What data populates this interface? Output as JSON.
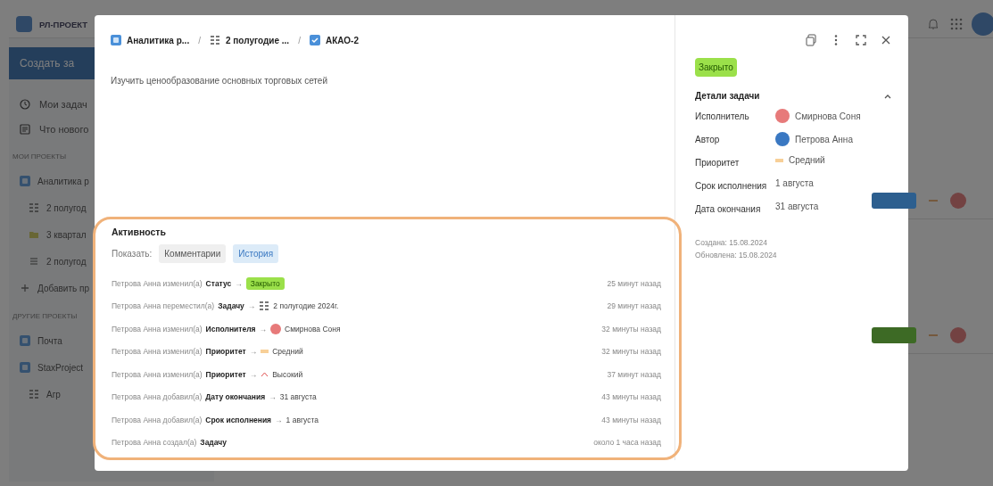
{
  "app": {
    "logo": "РЛ-ПРОЕКТ",
    "create_button": "Создать за",
    "nav": [
      {
        "label": "Мои задач",
        "kind": "clock"
      },
      {
        "label": "Что нового",
        "kind": "news"
      }
    ],
    "sections": [
      {
        "title": "МОИ ПРОЕКТЫ",
        "items": [
          {
            "label": "Аналитика р",
            "kind": "project",
            "children": [
              {
                "label": "2 полугод",
                "kind": "board"
              },
              {
                "label": "3 квартал",
                "kind": "folder"
              },
              {
                "label": "2 полугод",
                "kind": "list"
              }
            ]
          },
          {
            "label": "Добавить пр",
            "kind": "plus"
          }
        ]
      },
      {
        "title": "ДРУГИЕ ПРОЕКТЫ",
        "items": [
          {
            "label": "Почта",
            "kind": "project"
          },
          {
            "label": "StaxProject",
            "kind": "project",
            "children": [
              {
                "label": "Агр",
                "kind": "board"
              }
            ]
          }
        ]
      }
    ],
    "rows": [
      {
        "color": "#2d5f8f"
      },
      {
        "color": "#3d6a25"
      }
    ]
  },
  "modal": {
    "breadcrumbs": [
      {
        "label": "Аналитика р...",
        "kind": "project"
      },
      {
        "label": "2 полугодие ...",
        "kind": "board"
      },
      {
        "label": "АКАО-2",
        "kind": "task"
      }
    ],
    "separator": "/",
    "description": "Изучить ценообразование основных торговых сетей",
    "activity": {
      "title": "Активность",
      "show_label": "Показать:",
      "filters": [
        {
          "label": "Комментарии",
          "selected": false
        },
        {
          "label": "История",
          "selected": true
        }
      ],
      "entries": [
        {
          "actor": "Петрова Анна",
          "action": "изменил(а)",
          "field": "Статус",
          "kind": "badge",
          "value": "Закрыто",
          "time": "25 минут назад"
        },
        {
          "actor": "Петрова Анна",
          "action": "переместил(а)",
          "field": "Задачу",
          "kind": "board",
          "value": "2 полугодие 2024г.",
          "time": "29 минут назад"
        },
        {
          "actor": "Петрова Анна",
          "action": "изменил(а)",
          "field": "Исполнителя",
          "kind": "avatar",
          "value": "Смирнова Соня",
          "time": "32 минуты назад"
        },
        {
          "actor": "Петрова Анна",
          "action": "изменил(а)",
          "field": "Приоритет",
          "kind": "priority-medium",
          "value": "Средний",
          "time": "32 минуты назад"
        },
        {
          "actor": "Петрова Анна",
          "action": "изменил(а)",
          "field": "Приоритет",
          "kind": "priority-high",
          "value": "Высокий",
          "time": "37 минут назад"
        },
        {
          "actor": "Петрова Анна",
          "action": "добавил(а)",
          "field": "Дату окончания",
          "kind": "text",
          "value": "31 августа",
          "time": "43 минуты назад"
        },
        {
          "actor": "Петрова Анна",
          "action": "добавил(а)",
          "field": "Срок исполнения",
          "kind": "text",
          "value": "1 августа",
          "time": "43 минуты назад"
        },
        {
          "actor": "Петрова Анна",
          "action": "создал(а)",
          "field": "Задачу",
          "kind": "none",
          "time": "около 1 часа назад"
        }
      ],
      "arrow": "→"
    },
    "status_badge": "Закрыто",
    "details": {
      "title": "Детали задачи",
      "expanded": true,
      "fields": [
        {
          "label": "Исполнитель",
          "kind": "initials-avatar",
          "value": "Смирнова Соня"
        },
        {
          "label": "Автор",
          "kind": "photo-avatar",
          "value": "Петрова Анна"
        },
        {
          "label": "Приоритет",
          "kind": "priority-medium",
          "value": "Средний"
        },
        {
          "label": "Срок исполнения",
          "kind": "text",
          "value": "1 августа"
        },
        {
          "label": "Дата окончания",
          "kind": "text",
          "value": "31 августа"
        }
      ]
    },
    "created": "Создана: 15.08.2024",
    "updated": "Обновлена: 15.08.2024"
  }
}
